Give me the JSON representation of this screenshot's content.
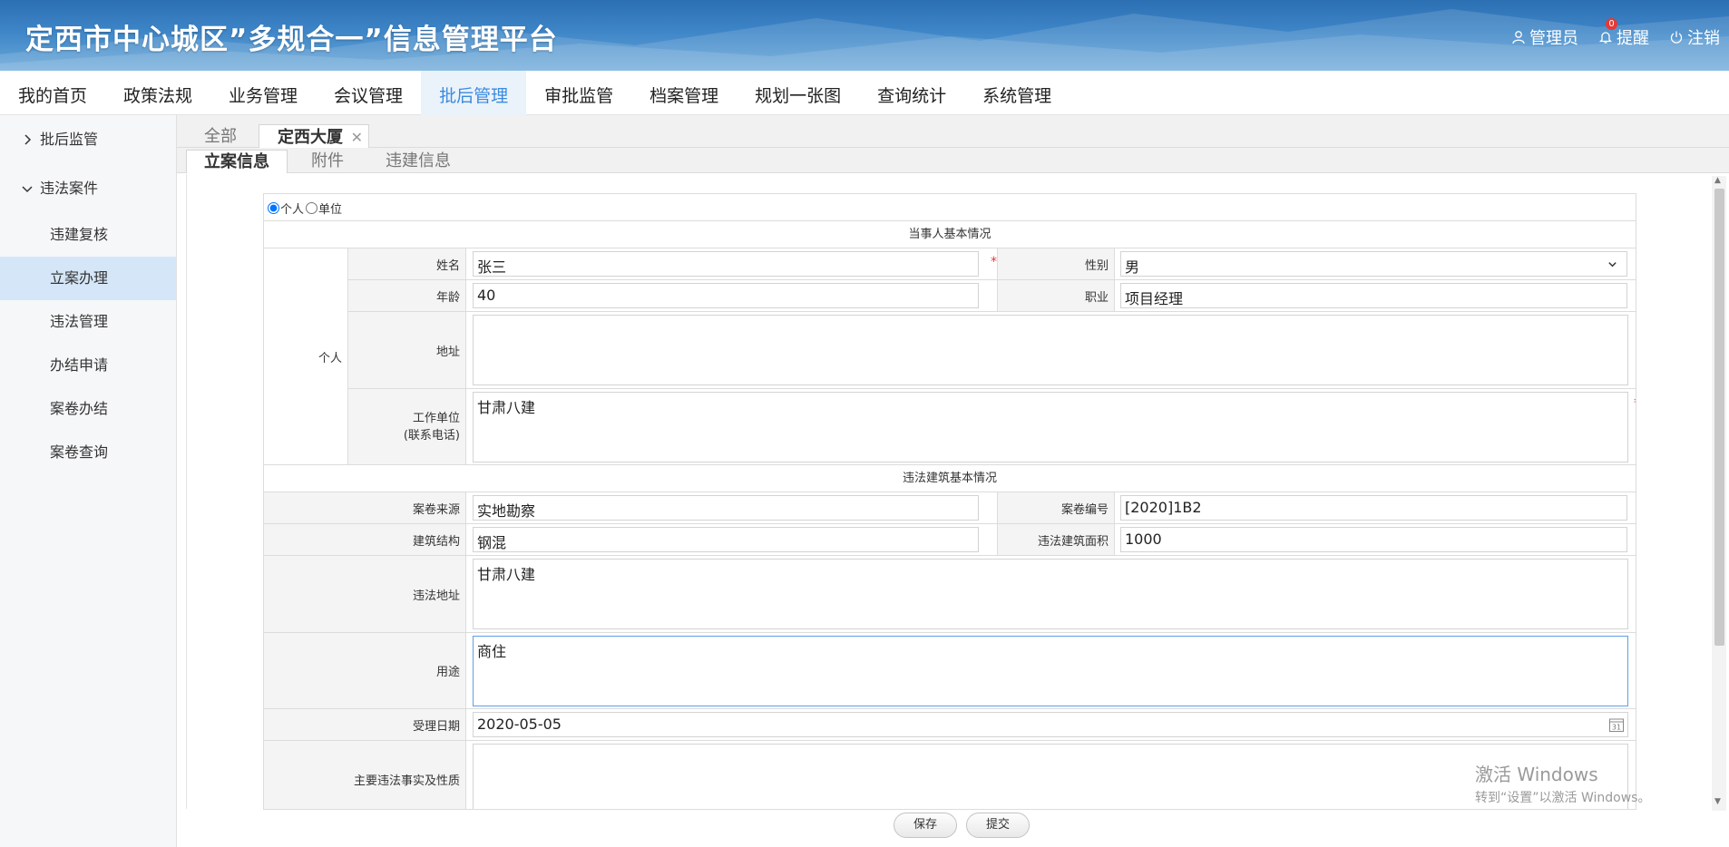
{
  "header": {
    "title": "定西市中心城区”多规合一”信息管理平台",
    "tools": [
      {
        "label": "管理员",
        "icon": "user-icon"
      },
      {
        "label": "提醒",
        "icon": "bell-icon",
        "badge": "0"
      },
      {
        "label": "注销",
        "icon": "power-icon"
      }
    ]
  },
  "nav": {
    "items": [
      "我的首页",
      "政策法规",
      "业务管理",
      "会议管理",
      "批后管理",
      "审批监管",
      "档案管理",
      "规划一张图",
      "查询统计",
      "系统管理"
    ],
    "active": "批后管理"
  },
  "sidebar": {
    "group1": "批后监管",
    "group2": "违法案件",
    "items": [
      "违建复核",
      "立案办理",
      "违法管理",
      "办结申请",
      "案卷办结",
      "案卷查询"
    ],
    "active": "立案办理"
  },
  "main_tabs": {
    "all": "全部",
    "active": "定西大厦"
  },
  "sub_tabs": [
    "立案信息",
    "附件",
    "违建信息"
  ],
  "form": {
    "radio": {
      "personal": "个人",
      "unit": "单位"
    },
    "section1": "当事人基本情况",
    "group_label": "个人",
    "name_label": "姓名",
    "name_value": "张三",
    "gender_label": "性别",
    "gender_value": "男",
    "age_label": "年龄",
    "age_value": "40",
    "job_label": "职业",
    "job_value": "项目经理",
    "address_label": "地址",
    "address_value": "",
    "work_label_1": "工作单位",
    "work_label_2": "(联系电话)",
    "work_value": "甘肃八建",
    "section2": "违法建筑基本情况",
    "source_label": "案卷来源",
    "source_value": "实地勘察",
    "caseno_label": "案卷编号",
    "caseno_value": "[2020]1B2",
    "struct_label": "建筑结构",
    "struct_value": "钢混",
    "area_label": "违法建筑面积",
    "area_value": "1000",
    "illegal_addr_label": "违法地址",
    "illegal_addr_value": "甘肃八建",
    "usage_label": "用途",
    "usage_value": "商住",
    "date_label": "受理日期",
    "date_value": "2020-05-05",
    "facts_label": "主要违法事实及性质",
    "facts_value": ""
  },
  "buttons": {
    "save": "保存",
    "submit": "提交"
  },
  "watermark": {
    "line1": "激活 Windows",
    "line2": "转到“设置”以激活 Windows。"
  }
}
